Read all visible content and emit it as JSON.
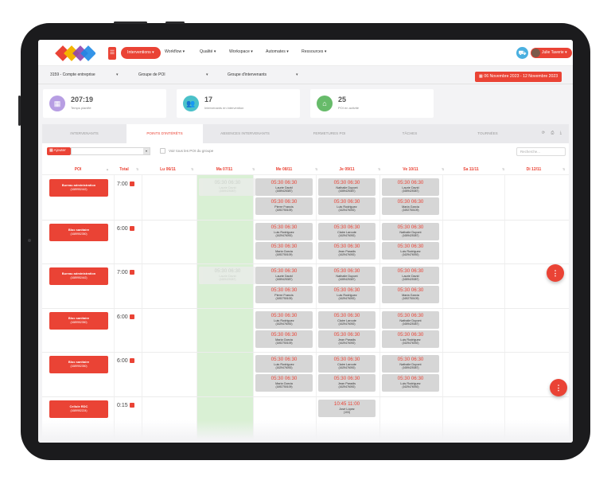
{
  "nav": {
    "active": "Interventions ▾",
    "items": [
      "Workflow ▾",
      "Qualité ▾",
      "Workspace ▾",
      "Automates ▾",
      "Ressources ▾"
    ],
    "user": "Julie Taverie ▾"
  },
  "filters": {
    "company": "3159 - Compte entreprise",
    "poi_group": "Groupe de POI",
    "intervenant_group": "Groupe d'intervenants",
    "date_range": "06 Novembre 2023 - 12 Novembre 2023"
  },
  "stats": [
    {
      "value": "207:19",
      "label": "Temps planifié",
      "color": "#b79ee3",
      "icon": "calendar-icon"
    },
    {
      "value": "17",
      "label": "Intervenants en intervention",
      "color": "#4bc1c9",
      "icon": "group-icon"
    },
    {
      "value": "25",
      "label": "POI en activité",
      "color": "#67bb6a",
      "icon": "home-icon"
    }
  ],
  "tabs": [
    "INTERVENANTS",
    "POINTS D'INTÉRÊTS",
    "ABSENCES INTERVENANTS",
    "FERMETURES POI",
    "TÂCHES",
    "TOURNÉES"
  ],
  "active_tab": 1,
  "toolbar": {
    "add_label": "Ajouter",
    "checkbox_label": "Voir tous les POI du groupe",
    "search_placeholder": "Recherche..."
  },
  "columns": [
    "POI",
    "Total",
    "Lu 06/11",
    "Ma 07/11",
    "Me 08/11",
    "Je 09/11",
    "Ve 10/11",
    "Sa 11/11",
    "Di 12/11"
  ],
  "rows": [
    {
      "poi": "Bureau administration",
      "code": "(1689952442)",
      "total": "7:00"
    },
    {
      "poi": "Bloc sanitaire",
      "code": "(1689952350)",
      "total": "6:00"
    },
    {
      "poi": "Bureau administration",
      "code": "(1689952442)",
      "total": "7:00"
    },
    {
      "poi": "Bloc sanitaire",
      "code": "(1689952350)",
      "total": "6:00"
    },
    {
      "poi": "Bloc sanitaire",
      "code": "(1689952350)",
      "total": "6:00"
    },
    {
      "poi": "Cellule RDC",
      "code": "(1689952224)",
      "total": "0:15"
    }
  ],
  "slot_time": "05:30 06:30",
  "people": {
    "laurie": {
      "name": "Laurie David",
      "id": "(1659425387)"
    },
    "pierre": {
      "name": "Pierre Francis",
      "id": "(1692750109)"
    },
    "luis": {
      "name": "Luis Rodriguez",
      "id": "(1629476092)"
    },
    "nathalie": {
      "name": "Nathalie Dupont",
      "id": "(1659425387)"
    },
    "maria": {
      "name": "Maria Garcia",
      "id": "(1692750109)"
    },
    "claire": {
      "name": "Claire Laroute",
      "id": "(1629476092)"
    },
    "jean": {
      "name": "Jean Paradis",
      "id": "(1629476092)"
    }
  },
  "last_slot": {
    "time": "10:45 11:00",
    "name": "José López",
    "id": "(103)"
  }
}
